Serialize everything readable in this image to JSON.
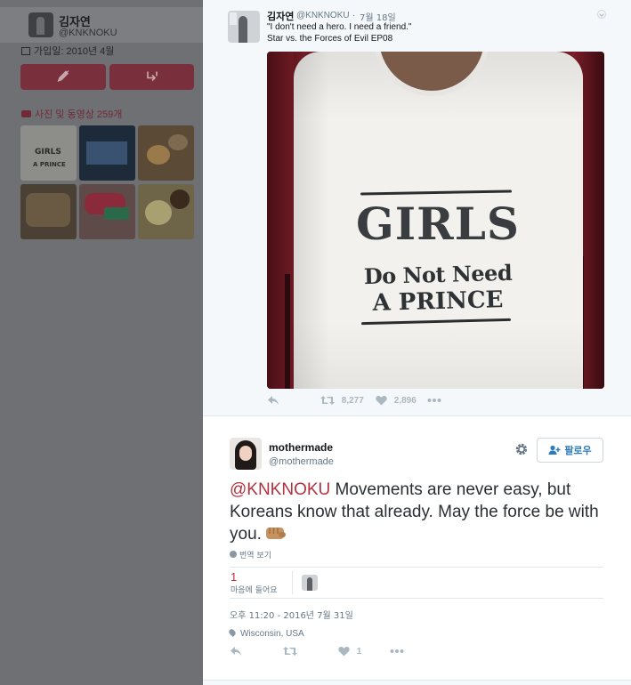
{
  "background_profile": {
    "name": "김자연",
    "handle": "@KNKNOKU",
    "joined": "가입일: 2010년 4월",
    "media_title": "사진 및 동영상 259개",
    "thumb_shirt_text": "GIRLS",
    "thumb_shirt_sub": "A PRINCE"
  },
  "quoted_tweet": {
    "name": "김자연",
    "handle": "@KNKNOKU",
    "separator": "·",
    "date": "7월 18일",
    "text_line1": "\"I don't need a hero. I need a friend.\"",
    "text_line2": "Star vs. the Forces of Evil EP08",
    "photo": {
      "shirt_line1": "GIRLS",
      "shirt_line2": "Do Not Need",
      "shirt_line3": "A PRINCE"
    },
    "retweets": "8,277",
    "likes": "2,896"
  },
  "main_tweet": {
    "name": "mothermade",
    "handle": "@mothermade",
    "follow_label": "팔로우",
    "mention": "@KNKNOKU",
    "text": " Movements are never easy, but Koreans know that already. May the force be with you.",
    "translate_label": "번역 보기",
    "likes_count": "1",
    "likes_label": "마음에 들어요",
    "timestamp": "오후 11:20 - 2016년 7월 31일",
    "location": "Wisconsin, USA",
    "action_likes": "1"
  },
  "colors": {
    "accent": "#b3323f",
    "link_blue": "#2b7bb9",
    "muted": "#657786",
    "icon": "#aab8c2"
  }
}
